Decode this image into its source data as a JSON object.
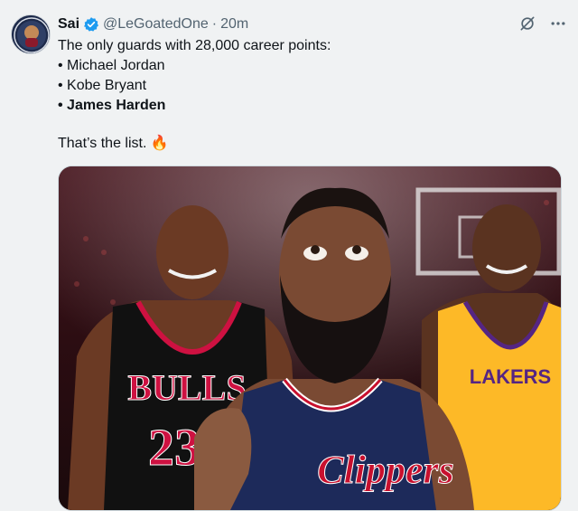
{
  "author": {
    "name": "Sai",
    "handle": "@LeGoatedOne",
    "separator": "·",
    "time": "20m",
    "verified_icon": "verified-badge-icon"
  },
  "icons": {
    "grok": "grok-icon",
    "more": "more-options-icon"
  },
  "post": {
    "line1": "The only guards with 28,000 career points:",
    "line2": "• Michael Jordan",
    "line3": "• Kobe Bryant",
    "line4": "• James Harden",
    "line5": "That’s the list. 🔥"
  },
  "media": {
    "jersey_left": "BULLS",
    "jersey_left_number": "23",
    "jersey_center": "Clippers",
    "jersey_right": "LAKERS"
  },
  "colors": {
    "accent": "#1d9bf0",
    "muted": "#536471",
    "bulls_red": "#ce1141",
    "clippers_navy": "#1d2a5a",
    "lakers_gold": "#fdb927"
  }
}
